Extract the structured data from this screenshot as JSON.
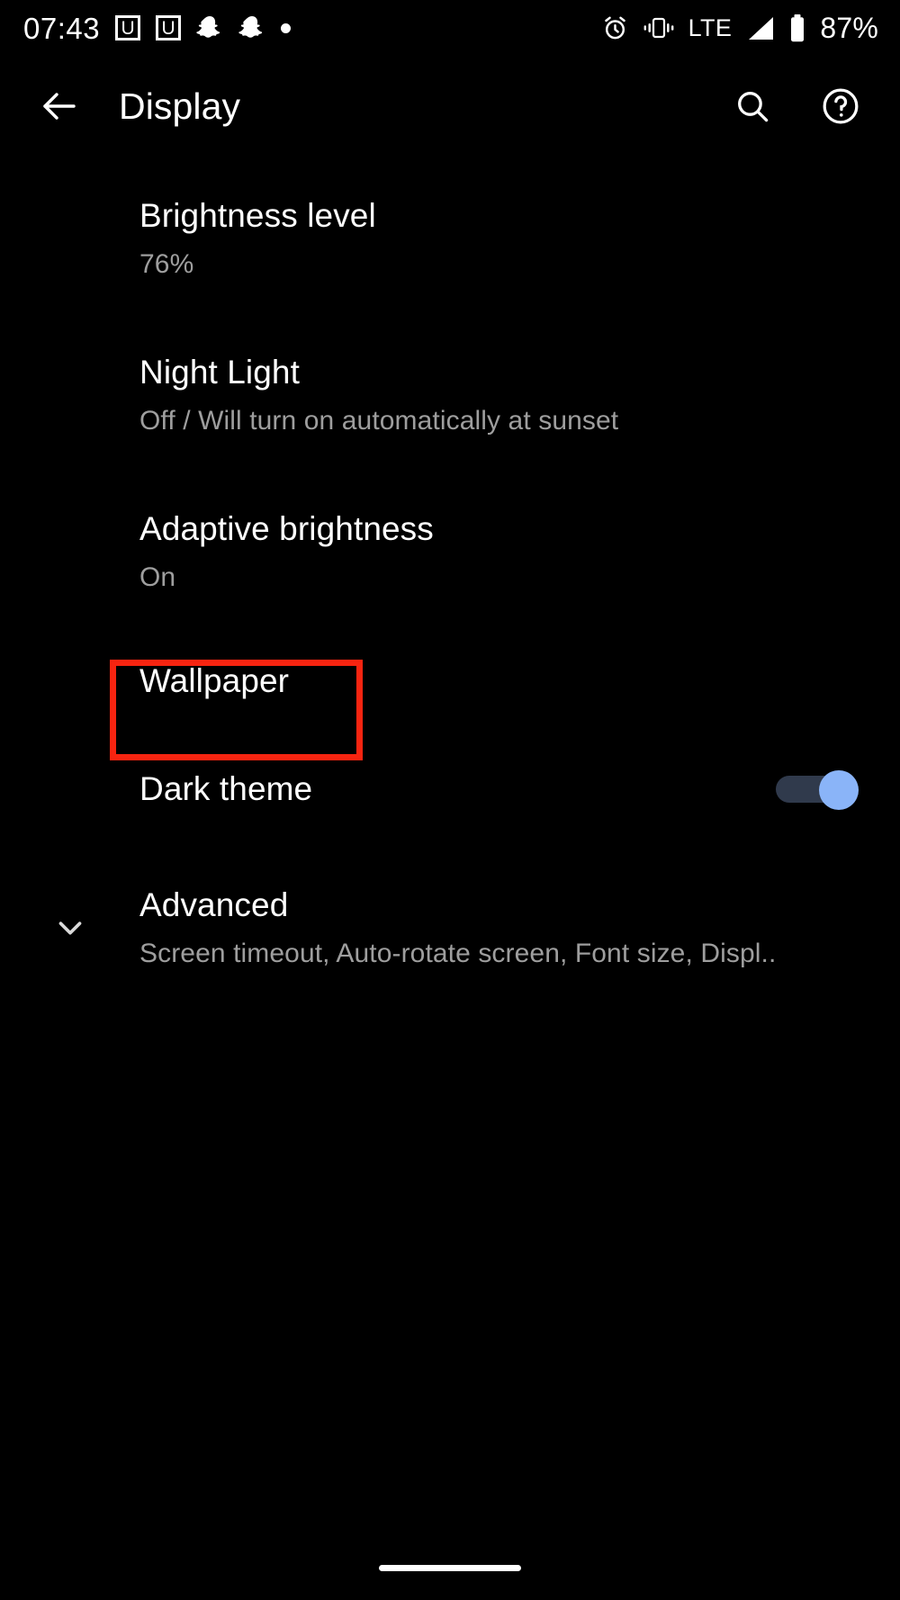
{
  "status_bar": {
    "clock": "07:43",
    "left_icons": [
      {
        "name": "u-badge-icon",
        "glyph": "U"
      },
      {
        "name": "u-badge-icon",
        "glyph": "U"
      },
      {
        "name": "snapchat-icon",
        "glyph": "snapchat"
      },
      {
        "name": "snapchat-icon",
        "glyph": "snapchat"
      },
      {
        "name": "dot-notification-icon",
        "glyph": "dot"
      }
    ],
    "right_icons": [
      {
        "name": "alarm-icon"
      },
      {
        "name": "vibrate-icon"
      },
      {
        "name": "signal-icon"
      },
      {
        "name": "battery-icon"
      }
    ],
    "network_type": "LTE",
    "battery_percent": "87%"
  },
  "app_bar": {
    "back_label": "back-arrow",
    "title": "Display",
    "search_label": "Search",
    "help_label": "Help"
  },
  "settings": {
    "items": [
      {
        "key": "brightness_level",
        "title": "Brightness level",
        "subtitle": "76%"
      },
      {
        "key": "night_light",
        "title": "Night Light",
        "subtitle": "Off / Will turn on automatically at sunset"
      },
      {
        "key": "adaptive_brightness",
        "title": "Adaptive brightness",
        "subtitle": "On"
      },
      {
        "key": "wallpaper",
        "title": "Wallpaper",
        "subtitle": ""
      },
      {
        "key": "dark_theme",
        "title": "Dark theme",
        "subtitle": "",
        "toggle_state": "on"
      },
      {
        "key": "advanced",
        "title": "Advanced",
        "subtitle": "Screen timeout, Auto-rotate screen, Font size, Displ.."
      }
    ]
  },
  "highlight": {
    "target": "Wallpaper",
    "color": "#f72410"
  },
  "colors": {
    "background": "#000000",
    "primary_text": "#ffffff",
    "secondary_text": "#9e9e9e",
    "accent": "#8ab4f8",
    "switch_track": "#303a4c",
    "highlight": "#f72410"
  },
  "nav": {
    "home_indicator": "home-indicator"
  }
}
